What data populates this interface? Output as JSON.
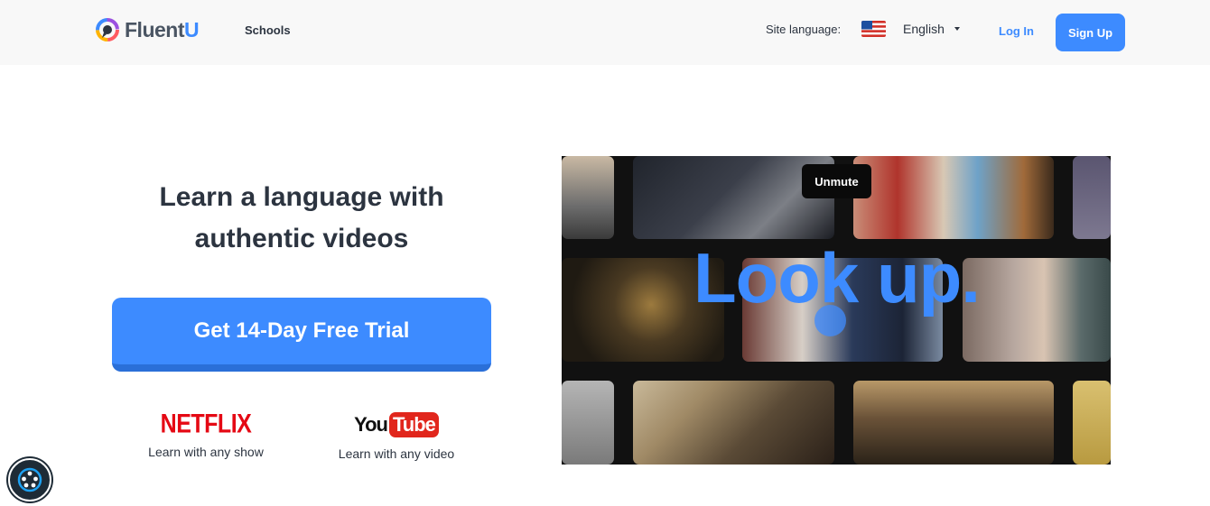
{
  "header": {
    "brand": {
      "name_a": "Fluent",
      "name_b": "U"
    },
    "nav": {
      "schools": "Schools"
    },
    "site_language_label": "Site language:",
    "language": {
      "selected": "English",
      "flag": "us-flag-icon"
    },
    "login_label": "Log In",
    "signup_label": "Sign Up"
  },
  "hero": {
    "headline_line1": "Learn a language with",
    "headline_line2": "authentic videos",
    "cta_label": "Get 14-Day Free Trial",
    "partners": [
      {
        "logo": "NETFLIX",
        "caption": "Learn with any show"
      },
      {
        "logo_a": "You",
        "logo_b": "Tube",
        "caption": "Learn with any video"
      }
    ]
  },
  "video": {
    "unmute_label": "Unmute",
    "caption": "Look up."
  },
  "colors": {
    "accent": "#3d8bff",
    "accent_dark": "#2a6fd8",
    "text": "#2c3440",
    "netflix_red": "#e50914",
    "youtube_red": "#e1261c",
    "header_bg": "#f8f8f8"
  },
  "icons": {
    "logo": "fluentu-globe-icon",
    "language_dropdown": "chevron-down-icon",
    "accessibility": "accessibility-icon"
  }
}
